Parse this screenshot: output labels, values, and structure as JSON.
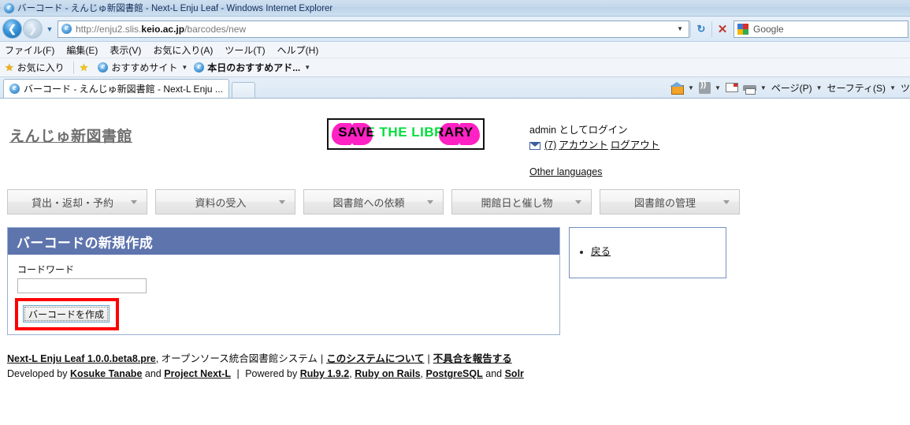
{
  "window": {
    "title": "バーコード - えんじゅ新図書館 - Next-L Enju Leaf - Windows Internet Explorer",
    "ie_icon": "ie-logo-icon"
  },
  "navbar": {
    "back_icon": "back-arrow-icon",
    "forward_icon": "forward-arrow-icon",
    "history_caret_icon": "chevron-down-icon",
    "address_url_prefix": "http://enju2.slis.",
    "address_url_domain": "keio.ac.jp",
    "address_url_path": "/barcodes/new",
    "address_full": "http://enju2.slis.keio.ac.jp/barcodes/new",
    "address_caret_icon": "chevron-down-icon",
    "refresh_icon": "refresh-icon",
    "stop_icon": "stop-x-icon",
    "search_engine": "Google",
    "search_icon": "google-icon"
  },
  "menubar": {
    "items": [
      {
        "label": "ファイル(F)"
      },
      {
        "label": "編集(E)"
      },
      {
        "label": "表示(V)"
      },
      {
        "label": "お気に入り(A)"
      },
      {
        "label": "ツール(T)"
      },
      {
        "label": "ヘルプ(H)"
      }
    ]
  },
  "favbar": {
    "favorites_label": "お気に入り",
    "favorites_icon": "star-icon",
    "add_icon": "add-to-favorites-icon",
    "items": [
      {
        "label": "おすすめサイト",
        "icon": "ie-logo-icon",
        "has_caret": true
      },
      {
        "label": "本日のおすすめアド...",
        "icon": "ie-logo-icon",
        "has_caret": true
      }
    ]
  },
  "tabs": {
    "active": "バーコード - えんじゅ新図書館 - Next-L Enju ...",
    "new_tab_label": ""
  },
  "toolbar_right": {
    "items": [
      {
        "icon": "home-icon",
        "label": "",
        "caret": true
      },
      {
        "icon": "rss-feed-icon",
        "label": "",
        "caret": true
      },
      {
        "icon": "mail-icon",
        "label": "",
        "caret": false
      },
      {
        "icon": "print-icon",
        "label": "",
        "caret": true
      },
      {
        "icon": "",
        "label": "ページ(P)",
        "caret": true
      },
      {
        "icon": "",
        "label": "セーフティ(S)",
        "caret": true
      },
      {
        "icon": "",
        "label": "ツ",
        "caret": false
      }
    ]
  },
  "page": {
    "site_title": "えんじゅ新図書館",
    "banner": {
      "text_save": "SAVE",
      "text_the": "THE",
      "text_library": "LIBRARY",
      "full_text": "SAVE THE LIBRARY",
      "color": "#ff21c3"
    },
    "login": {
      "user": "admin",
      "status_text": "admin としてログイン",
      "message_icon": "envelope-icon",
      "message_count": "(7)",
      "account_label": "アカウント",
      "logout_label": "ログアウト"
    },
    "other_languages": "Other languages",
    "nav_menu": [
      {
        "label": "貸出・返却・予約"
      },
      {
        "label": "資料の受入"
      },
      {
        "label": "図書館への依頼"
      },
      {
        "label": "開館日と催し物"
      },
      {
        "label": "図書館の管理"
      }
    ],
    "panel": {
      "title": "バーコードの新規作成",
      "header_color": "#5e74ad",
      "field_label": "コードワード",
      "field_value": "",
      "field_placeholder": "",
      "submit_label": "バーコードを作成",
      "highlight_color": "#ff0000"
    },
    "sidebox": {
      "items": [
        {
          "label": "戻る"
        }
      ]
    },
    "footer": {
      "line1": {
        "app_link": "Next-L Enju Leaf 1.0.0.beta8.pre",
        "description": ", オープンソース統合図書館システム",
        "about_link": "このシステムについて",
        "bug_link": "不具合を報告する"
      },
      "line2": {
        "developed_by": "Developed by",
        "author": "Kosuke Tanabe",
        "and": "and",
        "project": "Project Next-L",
        "powered_by": "Powered by",
        "tech1": "Ruby 1.9.2",
        "tech2": "Ruby on Rails",
        "tech3": "PostgreSQL",
        "and2": "and",
        "tech4": "Solr"
      }
    }
  }
}
